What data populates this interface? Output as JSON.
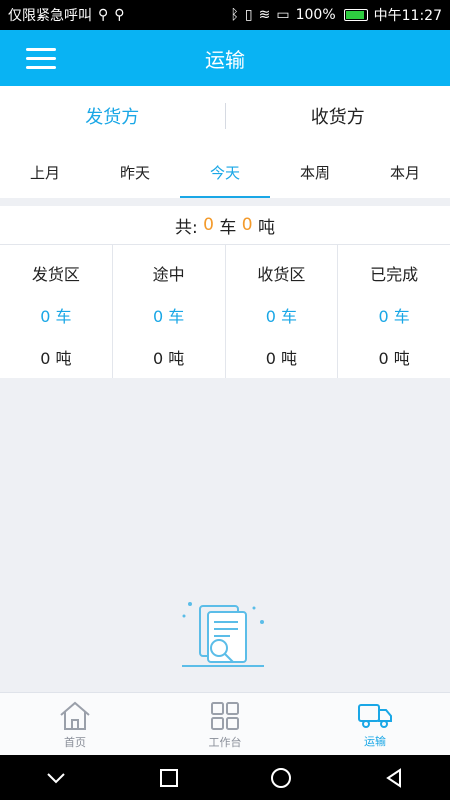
{
  "status_bar": {
    "left_text": "仅限紧急呼叫",
    "battery": "100%",
    "time": "中午11:27"
  },
  "header": {
    "title": "运输"
  },
  "role_tabs": [
    {
      "label": "发货方",
      "active": true
    },
    {
      "label": "收货方",
      "active": false
    }
  ],
  "period_tabs": [
    {
      "label": "上月"
    },
    {
      "label": "昨天"
    },
    {
      "label": "今天",
      "active": true
    },
    {
      "label": "本周"
    },
    {
      "label": "本月"
    }
  ],
  "summary": {
    "prefix": "共:",
    "car_count": "0",
    "car_unit": "车",
    "ton_count": "0",
    "ton_unit": "吨"
  },
  "stats": [
    {
      "title": "发货区",
      "cars": "0 车",
      "tons": "0 吨"
    },
    {
      "title": "途中",
      "cars": "0 车",
      "tons": "0 吨"
    },
    {
      "title": "收货区",
      "cars": "0 车",
      "tons": "0 吨"
    },
    {
      "title": "已完成",
      "cars": "0 车",
      "tons": "0 吨"
    }
  ],
  "bottom_nav": [
    {
      "label": "首页",
      "icon": "home-icon"
    },
    {
      "label": "工作台",
      "icon": "grid-icon"
    },
    {
      "label": "运输",
      "icon": "truck-icon",
      "active": true
    }
  ],
  "colors": {
    "primary": "#09b3f3",
    "accent_text": "#1aa7e6",
    "highlight": "#f39a2b"
  }
}
